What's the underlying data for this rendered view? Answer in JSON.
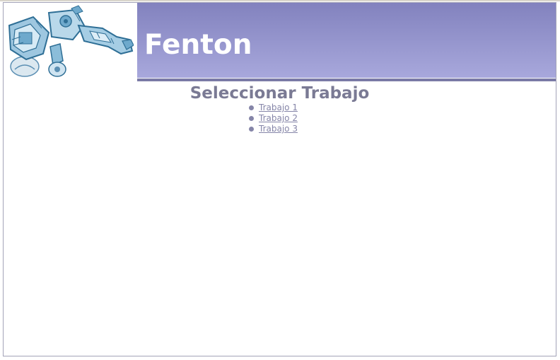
{
  "header": {
    "app_title": "Fenton",
    "logo_icon": "robot-arm-logo-icon"
  },
  "main": {
    "title": "Seleccionar Trabajo",
    "jobs": [
      {
        "label": "Trabajo 1"
      },
      {
        "label": "Trabajo 2"
      },
      {
        "label": "Trabajo 3"
      }
    ]
  },
  "colors": {
    "banner_top": "#8282be",
    "banner_bottom": "#a8a8dc",
    "title_text": "#7a7a94",
    "link": "#8585a8"
  }
}
